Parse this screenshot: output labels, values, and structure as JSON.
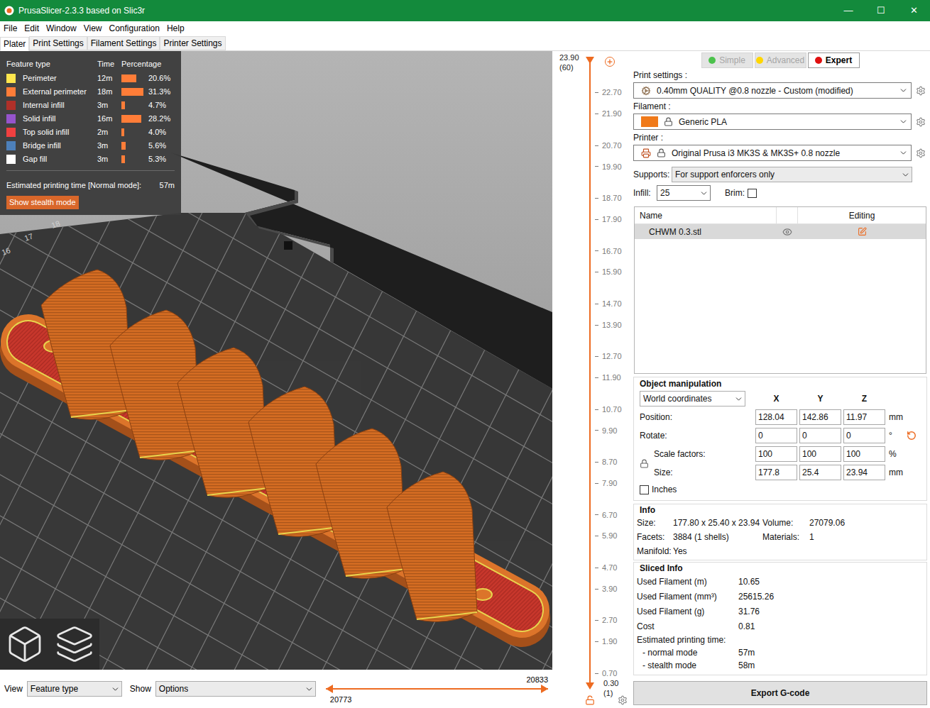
{
  "window": {
    "title": "PrusaSlicer-2.3.3 based on Slic3r",
    "controls": [
      "—",
      "☐",
      "✕"
    ]
  },
  "menu": [
    "File",
    "Edit",
    "Window",
    "View",
    "Configuration",
    "Help"
  ],
  "tabs": [
    {
      "label": "Plater",
      "selected": true
    },
    {
      "label": "Print Settings",
      "selected": false
    },
    {
      "label": "Filament Settings",
      "selected": false
    },
    {
      "label": "Printer Settings",
      "selected": false
    }
  ],
  "legend": {
    "columns": [
      "Feature type",
      "Time",
      "Percentage"
    ],
    "rows": [
      {
        "name": "Perimeter",
        "time": "12m",
        "percentage": "20.6%",
        "level": 0.206,
        "color": "#ffe64d"
      },
      {
        "name": "External perimeter",
        "time": "18m",
        "percentage": "31.3%",
        "level": 0.313,
        "color": "#ff7d38"
      },
      {
        "name": "Internal infill",
        "time": "3m",
        "percentage": "4.7%",
        "level": 0.047,
        "color": "#b03029"
      },
      {
        "name": "Solid infill",
        "time": "16m",
        "percentage": "28.2%",
        "level": 0.282,
        "color": "#9654cc"
      },
      {
        "name": "Top solid infill",
        "time": "2m",
        "percentage": "4.0%",
        "level": 0.04,
        "color": "#f04040"
      },
      {
        "name": "Bridge infill",
        "time": "3m",
        "percentage": "5.6%",
        "level": 0.056,
        "color": "#4d80ba"
      },
      {
        "name": "Gap fill",
        "time": "3m",
        "percentage": "5.3%",
        "level": 0.053,
        "color": "#ffffff"
      }
    ],
    "estimate_label": "Estimated printing time [Normal mode]:",
    "estimate": "57m",
    "button": "Show stealth mode"
  },
  "bed_numbers": [
    "18",
    "17",
    "16"
  ],
  "bottom_bar": {
    "view_label": "View",
    "view_value": "Feature type",
    "show_label": "Show",
    "show_value": "Options"
  },
  "h_slider": {
    "low": {
      "label": "20773",
      "level": 0
    },
    "high": {
      "label": "20833",
      "level": 1
    }
  },
  "v_slider": {
    "top_value": "23.90",
    "top_layer": "(60)",
    "bottom_value": "0.30",
    "bottom_layer": "(1)",
    "ticks": [
      "22.70",
      "21.90",
      "20.70",
      "19.90",
      "18.70",
      "17.90",
      "16.70",
      "15.90",
      "14.70",
      "13.90",
      "12.70",
      "11.90",
      "10.70",
      "9.90",
      "8.70",
      "7.90",
      "6.70",
      "5.90",
      "4.70",
      "3.90",
      "2.70",
      "1.90",
      "0.70"
    ]
  },
  "modes": [
    {
      "label": "Simple",
      "selected": false,
      "color": "#4cc24c"
    },
    {
      "label": "Advanced",
      "selected": false,
      "color": "#ffd600"
    },
    {
      "label": "Expert",
      "selected": true,
      "color": "#e01010"
    }
  ],
  "presets": [
    {
      "label": "Print settings :",
      "value": "0.40mm QUALITY @0.8 nozzle - Custom (modified)",
      "kind": "print"
    },
    {
      "label": "Filament :",
      "value": "Generic PLA",
      "kind": "filament",
      "color": "#f07a1a"
    },
    {
      "label": "Printer :",
      "value": "Original Prusa i3 MK3S & MK3S+ 0.8 nozzle",
      "kind": "printer"
    }
  ],
  "supports": {
    "label": "Supports:",
    "value": "For support enforcers only"
  },
  "infill": {
    "label": "Infill:",
    "value": "25"
  },
  "brim": {
    "label": "Brim:",
    "checked": false
  },
  "object_list": {
    "columns": [
      "Name",
      "Editing"
    ],
    "rows": [
      {
        "name": "CHWM 0.3.stl",
        "selected": true
      }
    ]
  },
  "object_manipulation": {
    "title": "Object manipulation",
    "coordinates": "World coordinates",
    "axes": [
      "X",
      "Y",
      "Z"
    ],
    "rows": [
      {
        "label": "Position:",
        "values": [
          "128.04",
          "142.86",
          "11.97"
        ],
        "unit": "mm",
        "kind": "plain"
      },
      {
        "label": "Rotate:",
        "values": [
          "0",
          "0",
          "0"
        ],
        "unit": "°",
        "kind": "reset"
      },
      {
        "label": "Scale factors:",
        "values": [
          "100",
          "100",
          "100"
        ],
        "unit": "%",
        "kind": "locked"
      },
      {
        "label": "Size:",
        "values": [
          "177.8",
          "25.4",
          "23.94"
        ],
        "unit": "mm",
        "kind": "locked"
      }
    ],
    "inches": {
      "label": "Inches",
      "checked": false
    }
  },
  "info": {
    "title": "Info",
    "rows": [
      [
        {
          "label": "Size:",
          "value": "177.80 x 25.40 x 23.94"
        },
        {
          "label": "Volume:",
          "value": "27079.06"
        }
      ],
      [
        {
          "label": "Facets:",
          "value": "3884 (1 shells)"
        },
        {
          "label": "Materials:",
          "value": "1"
        }
      ],
      [
        {
          "label": "Manifold:",
          "value": "Yes"
        }
      ]
    ]
  },
  "sliced_info": {
    "title": "Sliced Info",
    "items": [
      {
        "kind": "row",
        "label": "Used Filament (m)",
        "value": "10.65"
      },
      {
        "kind": "row",
        "label": "Used Filament (mm³)",
        "value": "25615.26"
      },
      {
        "kind": "row",
        "label": "Used Filament (g)",
        "value": "31.76"
      },
      {
        "kind": "row",
        "label": "Cost",
        "value": "0.81"
      },
      {
        "kind": "heading",
        "label": "Estimated printing time:"
      },
      {
        "kind": "subrow",
        "label": "- normal mode",
        "value": "57m"
      },
      {
        "kind": "subrow",
        "label": "- stealth mode",
        "value": "58m"
      }
    ]
  },
  "export_button": "Export G-code"
}
